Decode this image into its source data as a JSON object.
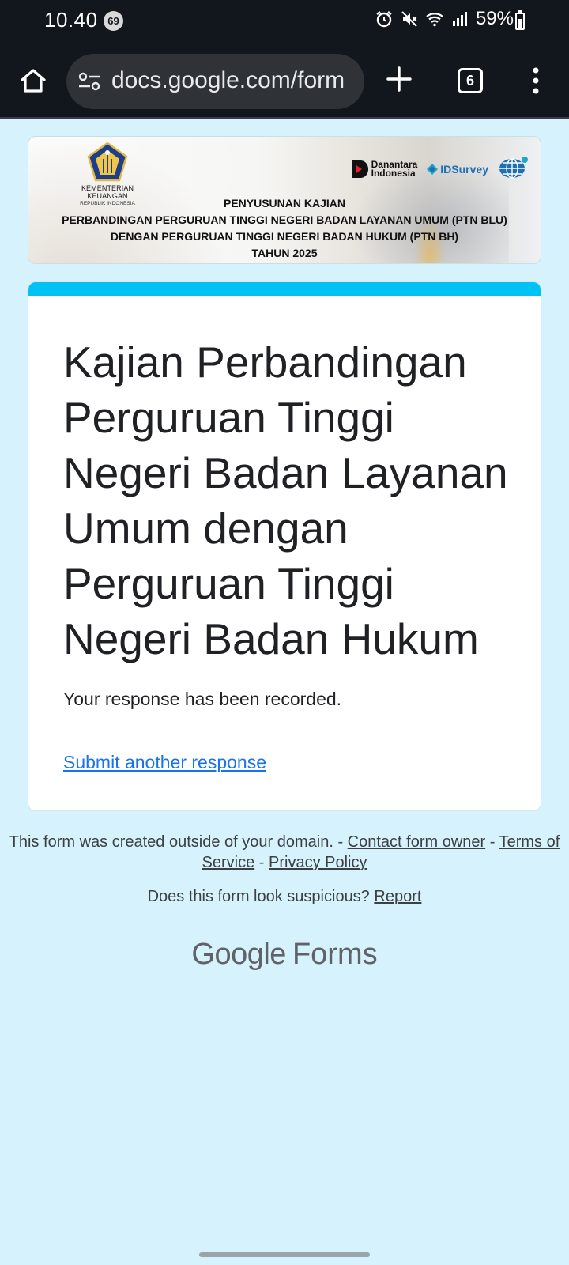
{
  "status_bar": {
    "time": "10.40",
    "notification_count": "69",
    "battery": "59%",
    "icons": [
      "alarm-icon",
      "mute-icon",
      "wifi-icon",
      "signal-icon",
      "battery-icon"
    ]
  },
  "browser": {
    "url": "docs.google.com/form",
    "tab_count": "6",
    "icons": [
      "home-icon",
      "site-settings-icon",
      "new-tab-icon",
      "tabs-icon",
      "more-menu-icon"
    ]
  },
  "banner": {
    "ministry_name": "KEMENTERIAN KEUANGAN",
    "ministry_sub": "REPUBLIK INDONESIA",
    "partner1_line1": "Danantara",
    "partner1_line2": "Indonesia",
    "partner2": "IDSurvey",
    "line1": "PENYUSUNAN KAJIAN",
    "line2": "PERBANDINGAN PERGURUAN TINGGI NEGERI BADAN LAYANAN UMUM (PTN BLU)",
    "line3": "DENGAN PERGURUAN TINGGI NEGERI BADAN HUKUM (PTN BH)",
    "line4": "TAHUN 2025"
  },
  "card": {
    "accent_color": "#00c3f5",
    "title": "Kajian Perbandingan Perguruan Tinggi Negeri Badan Layanan Umum dengan Perguruan Tinggi Negeri Badan Hukum",
    "confirmation": "Your response has been recorded.",
    "submit_another": "Submit another response"
  },
  "footer": {
    "created_outside": "This form was created outside of your domain. - ",
    "contact_owner": "Contact form owner",
    "sep1": " - ",
    "terms": "Terms of Service",
    "sep2": " - ",
    "privacy": "Privacy Policy",
    "suspicious": "Does this form look suspicious? ",
    "report": "Report",
    "brand_google": "Google",
    "brand_forms": "Forms"
  },
  "colors": {
    "page_background": "#d6f3fd",
    "link": "#1a73e8",
    "system_bar": "#12161d"
  }
}
